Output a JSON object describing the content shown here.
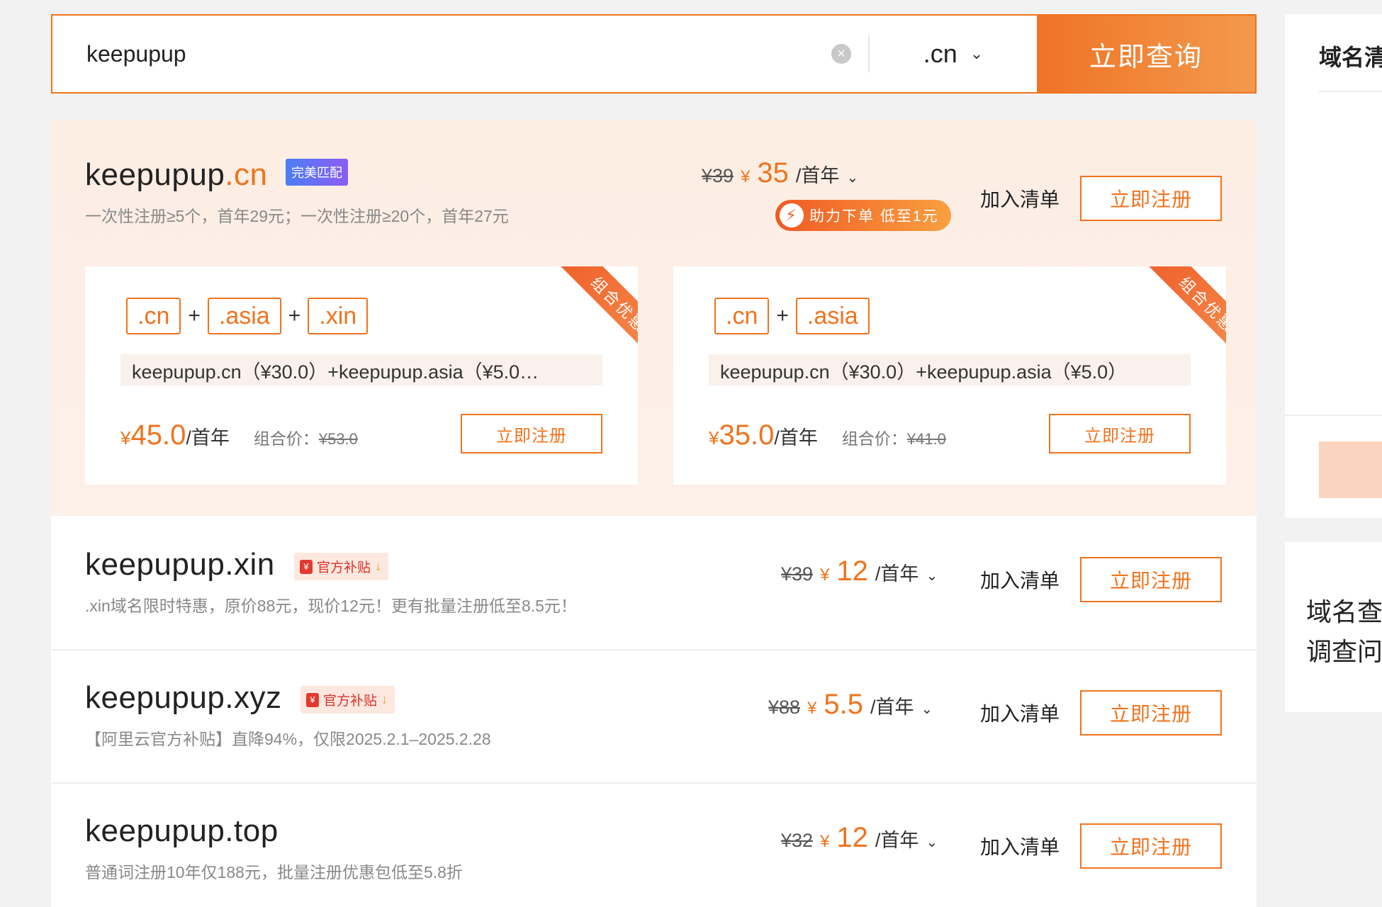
{
  "search": {
    "query": "keepupup",
    "clear_icon": "×",
    "suffix": ".cn",
    "button_label": "立即查询"
  },
  "sidebar": {
    "panel1_title": "域名清",
    "panel3_line1": "域名查",
    "panel3_line2": "调查问"
  },
  "featured": {
    "domain_name": "keepupup",
    "domain_tld": ".cn",
    "badge": "完美匹配",
    "description": "一次性注册≥5个，首年29元；一次性注册≥20个，首年27元",
    "old_price": "¥39",
    "yen": "¥",
    "price": "35",
    "unit": "/首年",
    "promo_text": "助力下单 低至1元",
    "add_label": "加入清单",
    "register_label": "立即注册"
  },
  "combos": [
    {
      "ribbon": "组合优惠",
      "tags": [
        ".cn",
        ".asia",
        ".xin"
      ],
      "items_text": "keepupup.cn（¥30.0）+keepupup.asia（¥5.0…",
      "yen": "¥",
      "price": "45.0",
      "unit": "/首年",
      "combo_label": "组合价：",
      "combo_orig": "¥53.0",
      "register_label": "立即注册"
    },
    {
      "ribbon": "组合优惠",
      "tags": [
        ".cn",
        ".asia"
      ],
      "items_text": "keepupup.cn（¥30.0）+keepupup.asia（¥5.0）",
      "yen": "¥",
      "price": "35.0",
      "unit": "/首年",
      "combo_label": "组合价：",
      "combo_orig": "¥41.0",
      "register_label": "立即注册"
    }
  ],
  "results": [
    {
      "domain_name": "keepupup",
      "domain_tld": ".xin",
      "badge": "官方补贴",
      "description": ".xin域名限时特惠，原价88元，现价12元！更有批量注册低至8.5元！",
      "old_price": "¥39",
      "yen": "¥",
      "price": "12",
      "unit": "/首年",
      "add_label": "加入清单",
      "register_label": "立即注册"
    },
    {
      "domain_name": "keepupup",
      "domain_tld": ".xyz",
      "badge": "官方补贴",
      "description": "【阿里云官方补贴】直降94%，仅限2025.2.1–2025.2.28",
      "old_price": "¥88",
      "yen": "¥",
      "price": "5.5",
      "unit": "/首年",
      "add_label": "加入清单",
      "register_label": "立即注册"
    },
    {
      "domain_name": "keepupup",
      "domain_tld": ".top",
      "description": "普通词注册10年仅188元，批量注册优惠包低至5.8折",
      "old_price": "¥32",
      "yen": "¥",
      "price": "12",
      "unit": "/首年",
      "add_label": "加入清单",
      "register_label": "立即注册"
    }
  ],
  "colors": {
    "accent": "#f0731d",
    "featured_bg": "#fdeee4"
  }
}
